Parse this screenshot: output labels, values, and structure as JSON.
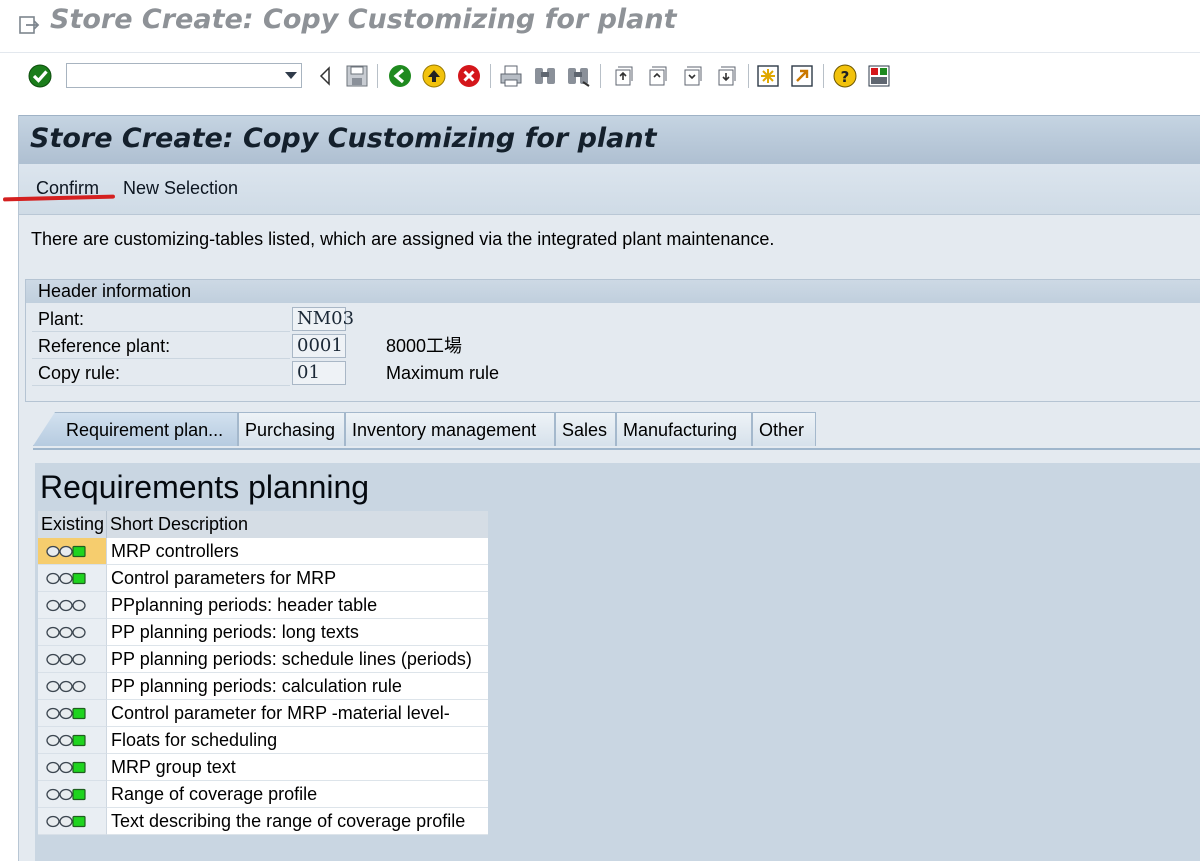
{
  "window": {
    "title": "Store Create: Copy Customizing for plant"
  },
  "toolbar": {
    "command_field_value": ""
  },
  "screen": {
    "title": "Store Create: Copy Customizing for plant"
  },
  "appbar": {
    "confirm_label": "Confirm",
    "new_selection_label": "New Selection"
  },
  "info_text": "There are customizing-tables listed, which are assigned via the integrated plant maintenance.",
  "header_info": {
    "title": "Header information",
    "fields": [
      {
        "label": "Plant:",
        "value": "NM03",
        "desc": ""
      },
      {
        "label": "Reference plant:",
        "value": "0001",
        "desc": "8000工場"
      },
      {
        "label": "Copy rule:",
        "value": "01",
        "desc": "Maximum rule"
      }
    ]
  },
  "tabs": [
    {
      "label": "Requirement plan...",
      "active": true
    },
    {
      "label": "Purchasing",
      "active": false
    },
    {
      "label": "Inventory management",
      "active": false
    },
    {
      "label": "Sales",
      "active": false
    },
    {
      "label": "Manufacturing",
      "active": false
    },
    {
      "label": "Other",
      "active": false
    }
  ],
  "panel": {
    "title": "Requirements planning",
    "columns": [
      "Existing",
      "Short Description"
    ],
    "rows": [
      {
        "status": "green",
        "description": "MRP controllers",
        "selected": true
      },
      {
        "status": "green",
        "description": "Control parameters for MRP"
      },
      {
        "status": "off",
        "description": "PPplanning periods: header table"
      },
      {
        "status": "off",
        "description": "PP planning periods: long texts"
      },
      {
        "status": "off",
        "description": "PP planning periods: schedule lines (periods)"
      },
      {
        "status": "off",
        "description": "PP planning periods: calculation rule"
      },
      {
        "status": "green",
        "description": "Control parameter for MRP -material level-"
      },
      {
        "status": "green",
        "description": "Floats for scheduling"
      },
      {
        "status": "green",
        "description": "MRP group text"
      },
      {
        "status": "green",
        "description": "Range of coverage profile"
      },
      {
        "status": "green",
        "description": "Text describing the range of coverage profile"
      }
    ]
  },
  "colors": {
    "green_light": "#1fd41f",
    "highlight": "#f6cd6e",
    "annotation": "#d42020"
  }
}
